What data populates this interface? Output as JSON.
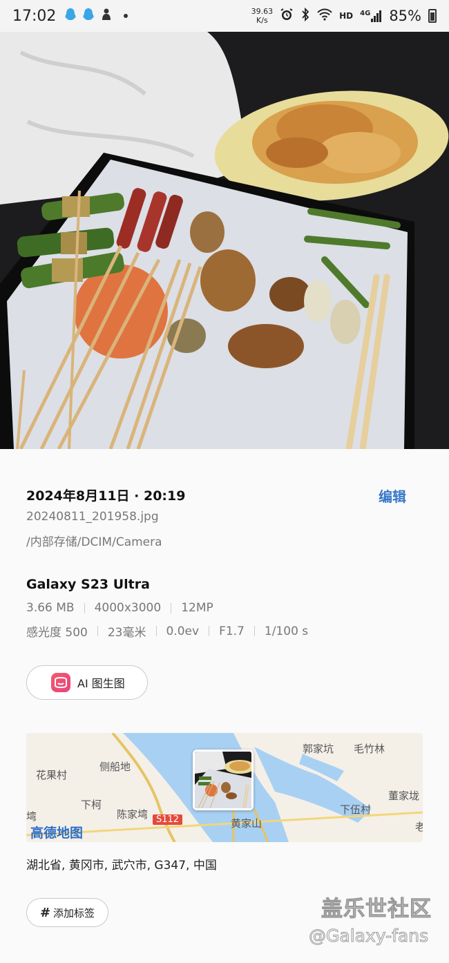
{
  "status_bar": {
    "time": "17:02",
    "net_speed_value": "39.63",
    "net_speed_unit": "K/s",
    "hd_label": "HD",
    "network_label": "4G",
    "battery_percent": "85%",
    "battery_level": 0.85,
    "left_icons": [
      "qq-icon",
      "qq-icon",
      "app-notification-icon",
      "more-dot-icon"
    ],
    "right_icons": [
      "alarm-icon",
      "bluetooth-icon",
      "wifi-icon",
      "signal-icon",
      "battery-icon"
    ]
  },
  "photo": {
    "description_icon": "photo-image"
  },
  "details": {
    "date_time": "2024年8月11日 · 20:19",
    "edit_label": "编辑",
    "filename": "20240811_201958.jpg",
    "path": "/内部存储/DCIM/Camera",
    "device": "Galaxy S23 Ultra",
    "size": "3.66 MB",
    "resolution": "4000x3000",
    "megapixels": "12MP",
    "iso": "感光度 500",
    "focal_length": "23毫米",
    "exposure": "0.0ev",
    "aperture": "F1.7",
    "shutter": "1/100 s"
  },
  "ai_button": {
    "label": "AI 图生图"
  },
  "map": {
    "labels": [
      "郭家坑",
      "毛竹林",
      "花果村",
      "侧船地",
      "董家垅",
      "下柯",
      "陈家塆",
      "下伍村",
      "塆",
      "黄家山",
      "老"
    ],
    "road_tag": "S112",
    "provider": "高德地图"
  },
  "address": "湖北省, 黄冈市, 武穴市, G347, 中国",
  "tag_button": {
    "icon": "#",
    "label": "添加标签"
  },
  "watermark": {
    "line1": "盖乐世社区",
    "line2": "@Galaxy-fans"
  },
  "colors": {
    "accent": "#3777c9",
    "text_secondary": "#777777"
  }
}
